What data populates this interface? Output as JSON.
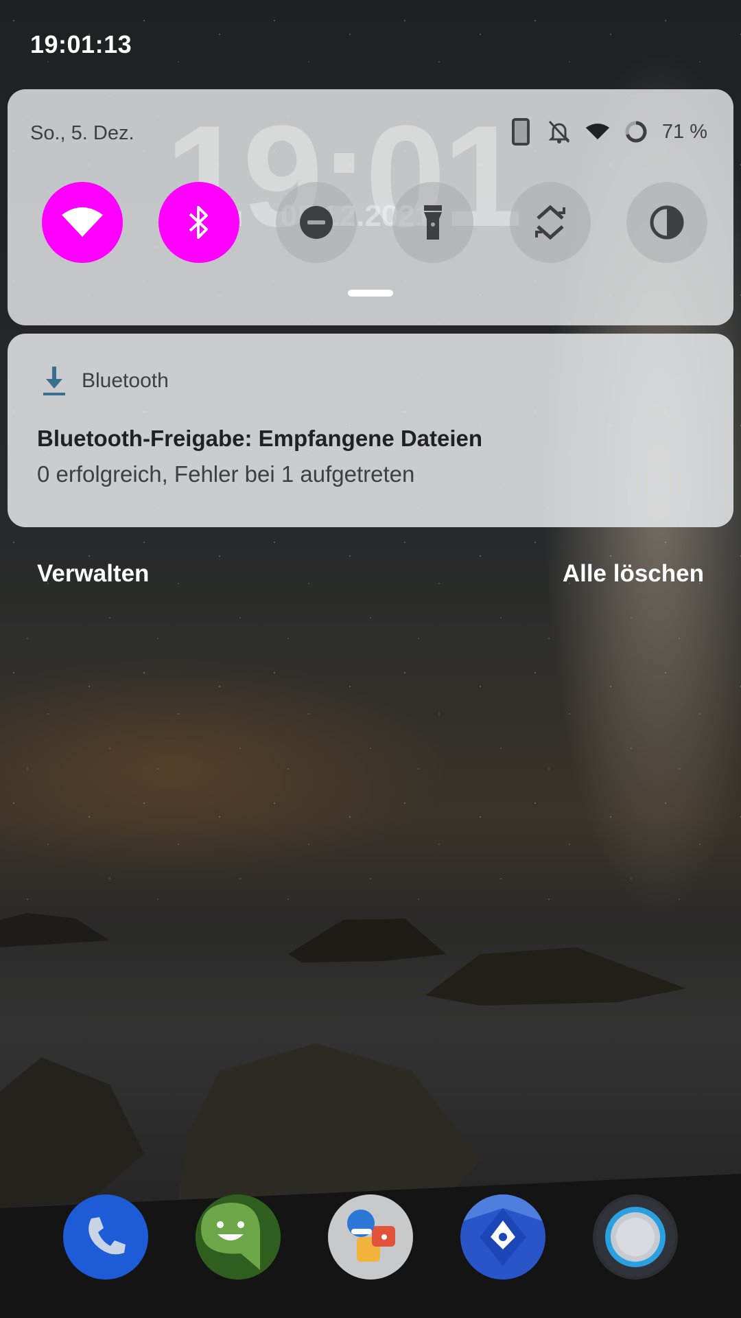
{
  "status_bar": {
    "time": "19:01:13"
  },
  "quick_settings": {
    "date": "So., 5. Dez.",
    "ghost_clock": "19:01",
    "ghost_date": "05.12.2021",
    "battery_percent": "71 %",
    "accent_color": "#ff00ff",
    "tiles": [
      {
        "name": "wifi",
        "icon": "wifi-icon",
        "state": "on"
      },
      {
        "name": "bluetooth",
        "icon": "bluetooth-icon",
        "state": "on"
      },
      {
        "name": "do-not-disturb",
        "icon": "dnd-icon",
        "state": "off"
      },
      {
        "name": "flashlight",
        "icon": "flashlight-icon",
        "state": "off"
      },
      {
        "name": "auto-rotate",
        "icon": "rotate-icon",
        "state": "off"
      },
      {
        "name": "invert-colors",
        "icon": "contrast-icon",
        "state": "off"
      }
    ]
  },
  "notification": {
    "app_name": "Bluetooth",
    "title": "Bluetooth-Freigabe: Empfangene Dateien",
    "text": "0 erfolgreich, Fehler bei 1 aufgetreten"
  },
  "footer": {
    "manage_label": "Verwalten",
    "clear_all_label": "Alle löschen"
  },
  "dock": [
    {
      "name": "phone",
      "icon": "phone-icon"
    },
    {
      "name": "messages",
      "icon": "messages-icon"
    },
    {
      "name": "contacts",
      "icon": "contacts-icon"
    },
    {
      "name": "maps",
      "icon": "maps-icon"
    },
    {
      "name": "camera",
      "icon": "camera-icon"
    }
  ]
}
